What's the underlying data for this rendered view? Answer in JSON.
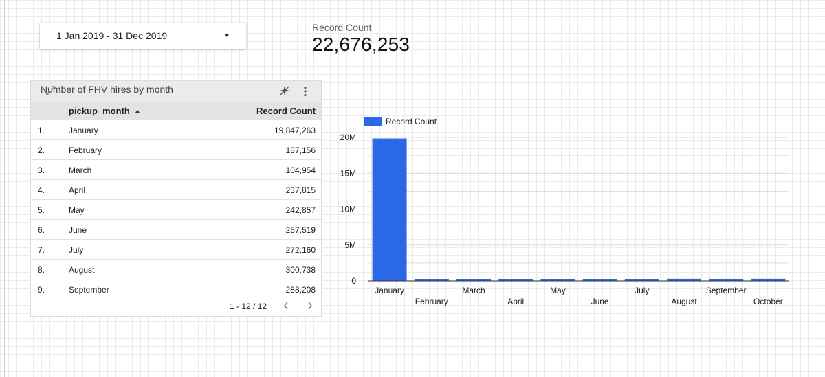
{
  "date_range": {
    "label": "1 Jan 2019 - 31 Dec 2019"
  },
  "scorecard": {
    "label": "Record Count",
    "value": "22,676,253"
  },
  "table": {
    "title": "Number of FHV hires by month",
    "headers": {
      "month": "pickup_month",
      "count": "Record Count"
    },
    "rows": [
      {
        "index": "1.",
        "month": "January",
        "count": "19,847,263"
      },
      {
        "index": "2.",
        "month": "February",
        "count": "187,156"
      },
      {
        "index": "3.",
        "month": "March",
        "count": "104,954"
      },
      {
        "index": "4.",
        "month": "April",
        "count": "237,815"
      },
      {
        "index": "5.",
        "month": "May",
        "count": "242,857"
      },
      {
        "index": "6.",
        "month": "June",
        "count": "257,519"
      },
      {
        "index": "7.",
        "month": "July",
        "count": "272,160"
      },
      {
        "index": "8.",
        "month": "August",
        "count": "300,738"
      },
      {
        "index": "9.",
        "month": "September",
        "count": "288,208"
      }
    ],
    "pagination": "1 - 12 / 12"
  },
  "chart_data": {
    "type": "bar",
    "categories": [
      "January",
      "February",
      "March",
      "April",
      "May",
      "June",
      "July",
      "August",
      "September",
      "October"
    ],
    "series": [
      {
        "name": "Record Count",
        "color": "#2a68e6",
        "values": [
          19847263,
          187156,
          104954,
          237815,
          242857,
          257519,
          272160,
          300738,
          288208,
          300000
        ]
      }
    ],
    "y_ticks": [
      "0",
      "5M",
      "10M",
      "15M",
      "20M"
    ],
    "ylim": [
      0,
      20000000
    ],
    "legend": "top-left",
    "grid": true
  },
  "colors": {
    "bar": "#2a68e6",
    "grid": "#e0e0e0",
    "header_bg": "#e3e3e3"
  }
}
